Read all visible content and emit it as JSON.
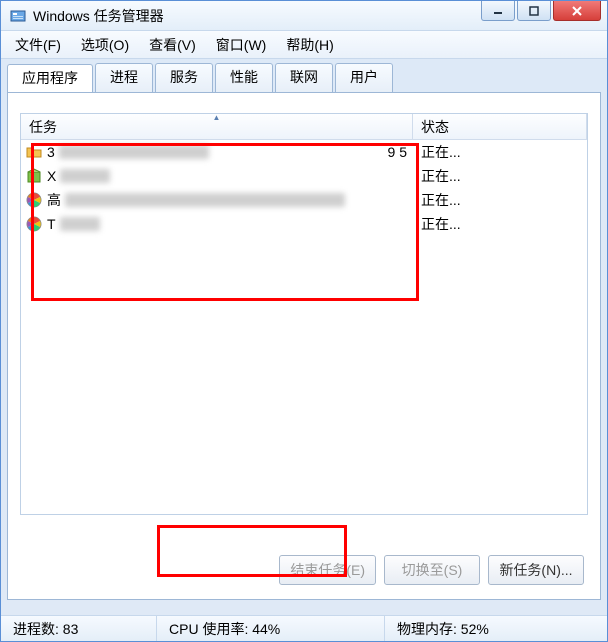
{
  "window": {
    "title": "Windows 任务管理器"
  },
  "menu": {
    "file": "文件(F)",
    "options": "选项(O)",
    "view": "查看(V)",
    "windows": "窗口(W)",
    "help": "帮助(H)"
  },
  "tabs": {
    "applications": "应用程序",
    "processes": "进程",
    "services": "服务",
    "performance": "性能",
    "networking": "联网",
    "users": "用户"
  },
  "columns": {
    "task": "任务",
    "status": "状态"
  },
  "rows": [
    {
      "icon": "folder",
      "name": "3",
      "suffix": "9 5",
      "status": "正在..."
    },
    {
      "icon": "box",
      "name": "X",
      "suffix": "",
      "status": "正在..."
    },
    {
      "icon": "wheel",
      "name": "高",
      "suffix": "",
      "status": "正在..."
    },
    {
      "icon": "wheel",
      "name": "T",
      "suffix": "",
      "status": "正在..."
    }
  ],
  "buttons": {
    "end_task": "结束任务(E)",
    "switch_to": "切换至(S)",
    "new_task": "新任务(N)..."
  },
  "status": {
    "processes": "进程数: 83",
    "cpu": "CPU 使用率: 44%",
    "memory": "物理内存: 52%"
  }
}
